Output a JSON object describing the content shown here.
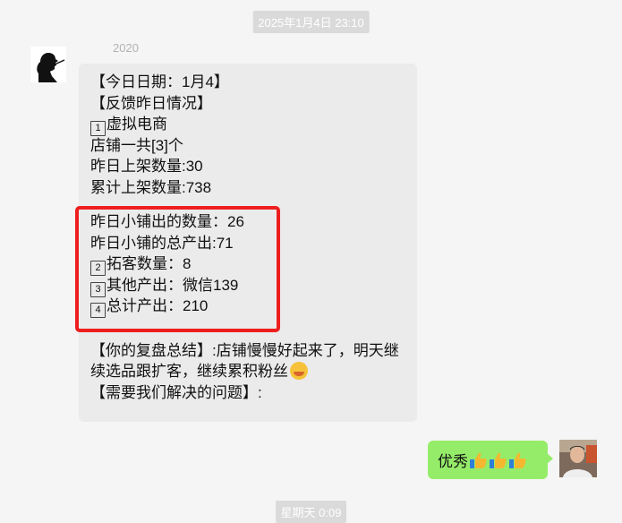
{
  "timestamps": {
    "top": "2025年1月4日 23:10",
    "bottom": "星期天 0:09"
  },
  "sender": {
    "name": "2020"
  },
  "message_left": {
    "lines_top": [
      "【今日日期：1月4】",
      "【反馈昨日情况】",
      "虚拟电商",
      "店铺一共[3]个",
      "昨日上架数量:30",
      "累计上架数量:738"
    ],
    "boxed_lines": [
      "昨日小铺出的数量：26",
      "昨日小铺的总产出:71",
      "拓客数量：8",
      "其他产出：微信139",
      "总计产出：210"
    ],
    "num_badges": [
      "1",
      "2",
      "3",
      "4"
    ],
    "summary_line1": "【你的复盘总结】:店铺慢慢好起来了，明天继",
    "summary_line2": "续选品跟扩客，继续累积粉丝",
    "question_line": "【需要我们解决的问题】:"
  },
  "message_right": {
    "text": "优秀"
  },
  "colors": {
    "self_bubble": "#95ec69",
    "other_bubble": "#ebebeb",
    "highlight_box": "#ee1e1e"
  }
}
